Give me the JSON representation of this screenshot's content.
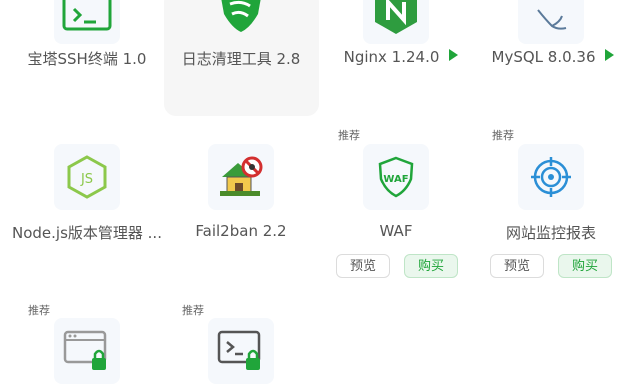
{
  "plugins": [
    {
      "name": "宝塔SSH终端 1.0",
      "icon": "terminal-icon"
    },
    {
      "name": "日志清理工具 2.8",
      "icon": "broom-shield-icon"
    },
    {
      "name": "Nginx 1.24.0",
      "icon": "nginx-icon",
      "has_play": true
    },
    {
      "name": "MySQL 8.0.36",
      "icon": "mysql-dolphin-icon",
      "has_play": true
    },
    {
      "name": "Node.js版本管理器 ...",
      "icon": "nodejs-icon"
    },
    {
      "name": "Fail2ban 2.2",
      "icon": "fail2ban-icon"
    },
    {
      "name": "WAF",
      "icon": "waf-shield-icon",
      "tag": "推荐",
      "preview_label": "预览",
      "buy_label": "购买"
    },
    {
      "name": "网站监控报表",
      "icon": "monitor-target-icon",
      "tag": "推荐",
      "preview_label": "预览",
      "buy_label": "购买"
    },
    {
      "name": "",
      "icon": "browser-lock-icon",
      "tag": "推荐"
    },
    {
      "name": "",
      "icon": "terminal-lock-icon",
      "tag": "推荐"
    }
  ],
  "colors": {
    "accent": "#20a53a",
    "icon_bg": "#f5f8fc",
    "hover_bg": "#f6f6f6"
  }
}
